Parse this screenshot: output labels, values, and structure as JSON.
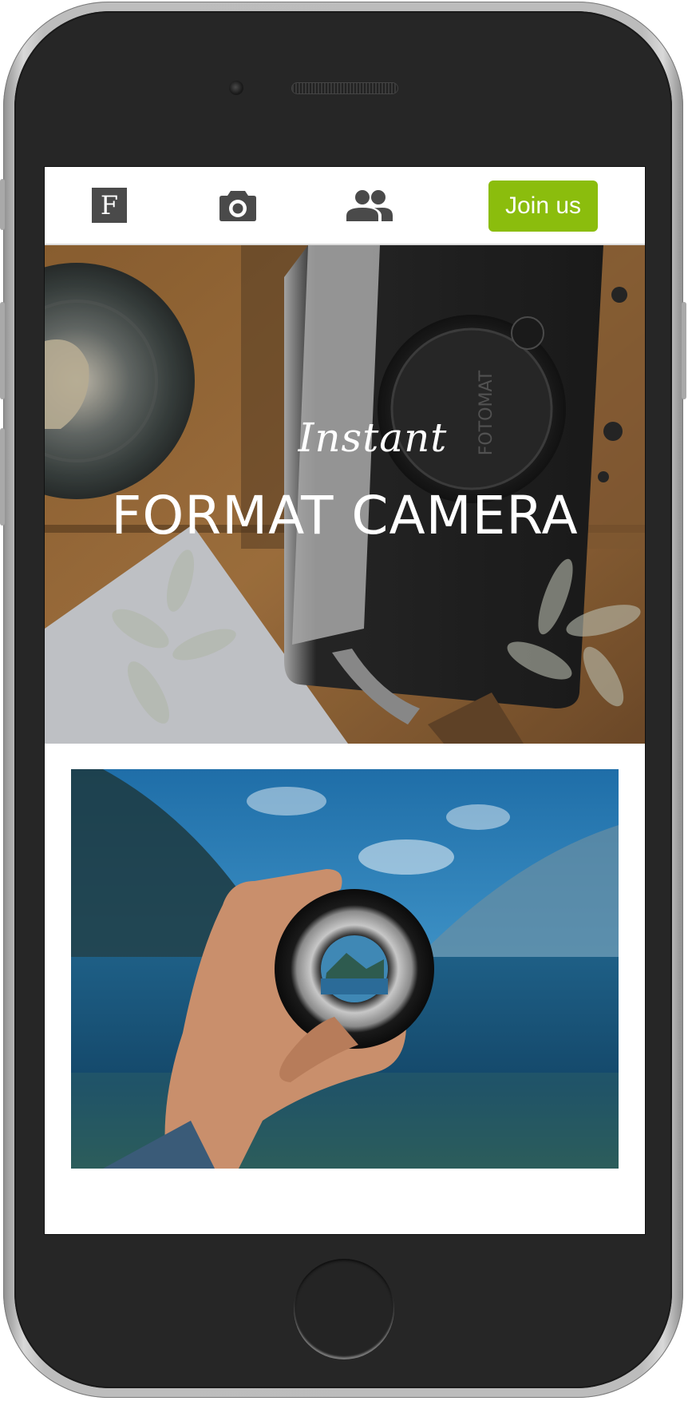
{
  "nav": {
    "logo_letter": "F",
    "join_label": "Join us",
    "join_color": "#8bbd0d"
  },
  "hero": {
    "script_text": "Instant",
    "title": "FORMAT CAMERA",
    "camera_cap_text": "FOTOMAT"
  }
}
